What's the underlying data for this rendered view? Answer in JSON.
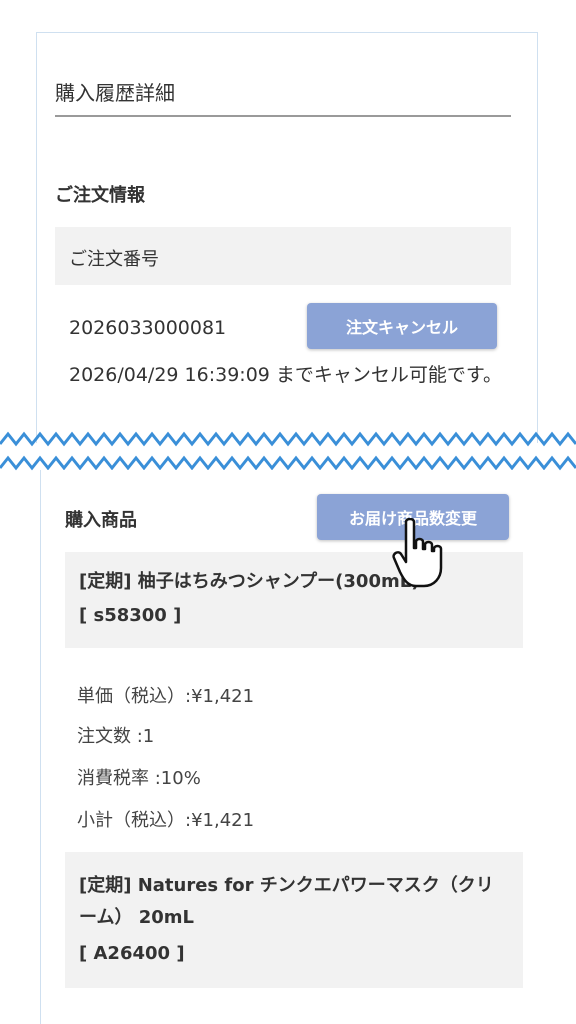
{
  "page_title": "購入履歴詳細",
  "order_info": {
    "heading": "ご注文情報",
    "number_label": "ご注文番号",
    "number_value": "2026033000081",
    "cancel_button": "注文キャンセル",
    "cancel_deadline": "2026/04/29 16:39:09 までキャンセル可能です。"
  },
  "purchased": {
    "heading": "購入商品",
    "change_button": "お届け商品数変更",
    "items": [
      {
        "name": "[定期] 柚子はちみつシャンプー(300mL)",
        "code": "[ s58300 ]",
        "unit_price": "単価（税込）:¥1,421",
        "quantity": "注文数 :1",
        "tax_rate": "消費税率 :10%",
        "subtotal": "小計（税込）:¥1,421"
      },
      {
        "name": "[定期] Natures for チンクエパワーマスク（クリーム） 20mL",
        "code": "[ A26400 ]"
      }
    ]
  },
  "colors": {
    "button": "#8ba3d6",
    "wave": "#3a8fd8",
    "label_bg": "#f2f2f2"
  }
}
